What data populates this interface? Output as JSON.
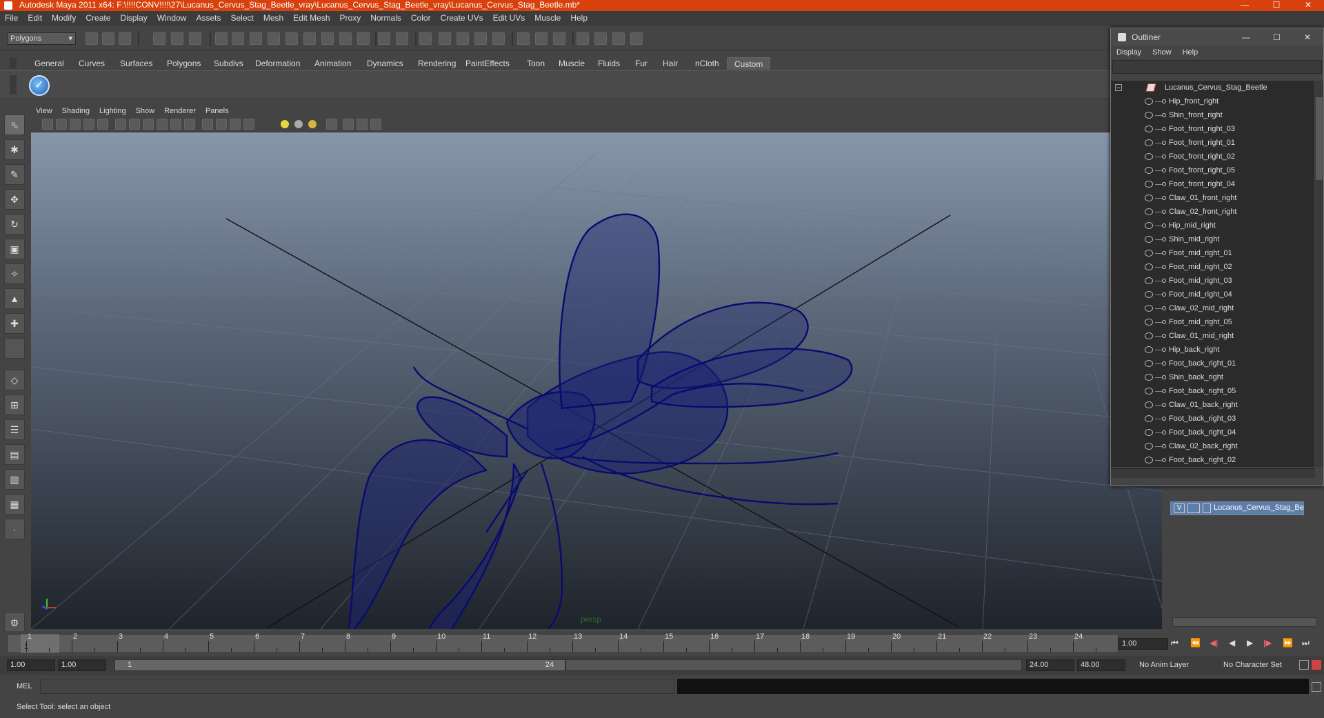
{
  "title": "Autodesk Maya 2011 x64: F:\\!!!!CONV!!!!\\27\\Lucanus_Cervus_Stag_Beetle_vray\\Lucanus_Cervus_Stag_Beetle_vray\\Lucanus_Cervus_Stag_Beetle.mb*",
  "menu": [
    "File",
    "Edit",
    "Modify",
    "Create",
    "Display",
    "Window",
    "Assets",
    "Select",
    "Mesh",
    "Edit Mesh",
    "Proxy",
    "Normals",
    "Color",
    "Create UVs",
    "Edit UVs",
    "Muscle",
    "Help"
  ],
  "mode_select": "Polygons",
  "shelf_tabs": [
    "General",
    "Curves",
    "Surfaces",
    "Polygons",
    "Subdivs",
    "Deformation",
    "Animation",
    "Dynamics",
    "Rendering",
    "PaintEffects",
    "Toon",
    "Muscle",
    "Fluids",
    "Fur",
    "Hair",
    "nCloth",
    "Custom"
  ],
  "shelf_active": "Custom",
  "viewport_menu": [
    "View",
    "Shading",
    "Lighting",
    "Show",
    "Renderer",
    "Panels"
  ],
  "viewport_camera_label": "persp",
  "outliner": {
    "title": "Outliner",
    "menu": [
      "Display",
      "Show",
      "Help"
    ],
    "root": "Lucanus_Cervus_Stag_Beetle",
    "items": [
      "Hip_front_right",
      "Shin_front_right",
      "Foot_front_right_03",
      "Foot_front_right_01",
      "Foot_front_right_02",
      "Foot_front_right_05",
      "Foot_front_right_04",
      "Claw_01_front_right",
      "Claw_02_front_right",
      "Hip_mid_right",
      "Shin_mid_right",
      "Foot_mid_right_01",
      "Foot_mid_right_02",
      "Foot_mid_right_03",
      "Foot_mid_right_04",
      "Claw_02_mid_right",
      "Foot_mid_right_05",
      "Claw_01_mid_right",
      "Hip_back_right",
      "Foot_back_right_01",
      "Shin_back_right",
      "Foot_back_right_05",
      "Claw_01_back_right",
      "Foot_back_right_03",
      "Foot_back_right_04",
      "Claw_02_back_right",
      "Foot_back_right_02"
    ]
  },
  "layer": {
    "visible_flag": "V",
    "name": "Lucanus_Cervus_Stag_Be"
  },
  "timeline": {
    "ticks": [
      "1",
      "2",
      "3",
      "4",
      "5",
      "6",
      "7",
      "8",
      "9",
      "10",
      "11",
      "12",
      "13",
      "14",
      "15",
      "16",
      "17",
      "18",
      "19",
      "20",
      "21",
      "22",
      "23",
      "24"
    ],
    "current_frame_marker": "1",
    "current_time": "1.00"
  },
  "range": {
    "start_time": "1.00",
    "start_playback": "1.00",
    "slider_start": "1",
    "slider_end": "24",
    "end_playback": "24.00",
    "end_time": "48.00",
    "anim_layer": "No Anim Layer",
    "character_set": "No Character Set"
  },
  "cmd_label": "MEL",
  "help_line": "Select Tool: select an object",
  "colors": {
    "title_bar": "#d8400c",
    "wireframe": "#0a0a6e",
    "layer_highlight": "#5d7ea8"
  }
}
